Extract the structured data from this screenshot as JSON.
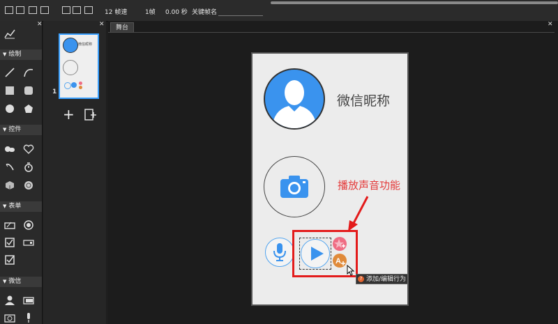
{
  "toolbar": {
    "fps": "12 帧速",
    "frame": "1帧",
    "time": "0.00 秒",
    "keyframe_label": "关键帧名",
    "keyframe_value": ""
  },
  "tools": {
    "sections": {
      "draw": "绘制",
      "control": "控件",
      "form": "表单",
      "wechat": "微信"
    }
  },
  "pages": {
    "page_number": "1",
    "thumb_text": "微信昵称",
    "add_label": "+"
  },
  "stage": {
    "tab": "舞台",
    "nickname": "微信昵称",
    "annotation": "播放声音功能",
    "tooltip": "添加/编辑行为"
  },
  "colors": {
    "accent_blue": "#3a93ee",
    "annotation_red": "#e31b1b",
    "pink": "#ef6d83",
    "orange": "#e08a3a"
  }
}
